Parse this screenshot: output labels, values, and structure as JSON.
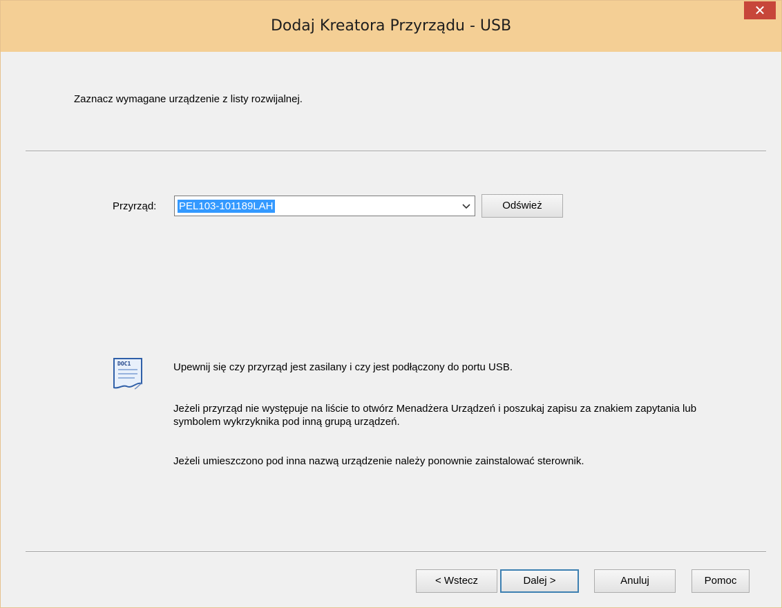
{
  "window": {
    "title": "Dodaj Kreatora Przyrządu - USB",
    "close_glyph": "✕",
    "titlebar_color": "#f4cf95",
    "close_color": "#c7463a"
  },
  "instruction": "Zaznacz wymagane urządzenie z listy rozwijalnej.",
  "device": {
    "label": "Przyrząd:",
    "selected_value": "PEL103-101189LAH",
    "dropdown_icon": "chevron-down-icon",
    "refresh_label": "Odśwież"
  },
  "notes": {
    "icon": "document-icon",
    "icon_text": "DOC1",
    "line1": "Upewnij się czy przyrząd jest zasilany i czy jest podłączony do portu USB.",
    "line2": "Jeżeli przyrząd nie występuje na liście to otwórz Menadżera Urządzeń i poszukaj zapisu za znakiem zapytania lub symbolem wykrzyknika pod inną grupą urządzeń.",
    "line3": "Jeżeli umieszczono pod inna nazwą urządzenie należy ponownie zainstalować sterownik."
  },
  "buttons": {
    "back": "< Wstecz",
    "next": "Dalej >",
    "cancel": "Anuluj",
    "help": "Pomoc"
  },
  "colors": {
    "selection": "#3399ff",
    "default_button_border": "#3c7fb1"
  }
}
